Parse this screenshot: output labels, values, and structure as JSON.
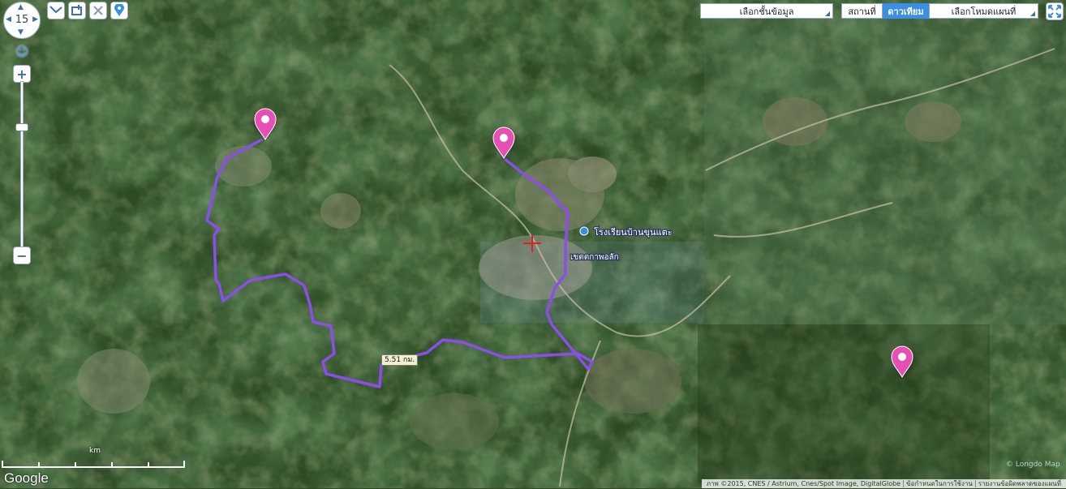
{
  "map": {
    "zoom_level": "15",
    "distance_label": "5.51 กม.",
    "place_labels": [
      "โรงเรียนบ้านขุนแตะ",
      "เขตตกาพอลัก"
    ],
    "scale_unit": "km",
    "google_logo": "Google",
    "watermark": "© Longdo Map",
    "route_color": "#8a4fe8",
    "marker_color": "#e84fb4"
  },
  "toolbar": {
    "layer_select": "เลือกชั้นข้อมูล",
    "mode_select": "เลือกโหมดแผนที่",
    "tab_station": "สถานที่",
    "tab_satellite": "ดาวเทียม"
  },
  "attribution": {
    "imagery": "ภาพ ©2015, CNES / Astrium, Cnes/Spot Image, DigitalGlobe",
    "terms": "ข้อกำหนดในการใช้งาน",
    "report": "รายงานข้อผิดพลาดของแผนที่"
  },
  "colors": {
    "accent": "#3a8ee6",
    "control_border": "#99aabb"
  }
}
